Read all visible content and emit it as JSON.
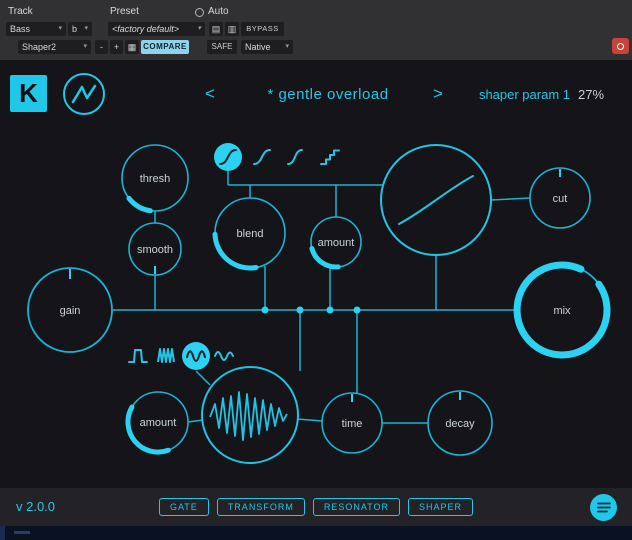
{
  "chrome": {
    "track_label": "Track",
    "preset_label": "Preset",
    "auto_label": "Auto",
    "track_value": "Bass",
    "track_sub_value": "b",
    "preset_value": "<factory default>",
    "bypass_label": "BYPASS",
    "device_value": "Shaper2",
    "minus_label": "-",
    "plus_label": "+",
    "compare_label": "COMPARE",
    "safe_label": "SAFE",
    "mode_value": "Native"
  },
  "header": {
    "logo_letter": "K",
    "prev_arrow": "<",
    "next_arrow": ">",
    "preset_title": "* gentle overload",
    "param_name": "shaper param 1",
    "param_value": "27%"
  },
  "graph": {
    "knobs": {
      "thresh": "thresh",
      "smooth": "smooth",
      "blend": "blend",
      "amount_top": "amount",
      "cut": "cut",
      "gain": "gain",
      "mix": "mix",
      "amount_bottom": "amount",
      "time": "time",
      "decay": "decay"
    }
  },
  "footer": {
    "version": "v 2.0.0",
    "tabs": [
      {
        "label": "GATE"
      },
      {
        "label": "TRANSFORM"
      },
      {
        "label": "RESONATOR"
      },
      {
        "label": "SHAPER"
      }
    ]
  },
  "icons": {
    "caret": "▾",
    "copy": "▤",
    "save": "▥",
    "slot": "▦"
  },
  "colors": {
    "accent": "#1fc9ea",
    "accent_dim": "#19b4d4",
    "compare_bg": "#8fd2ec",
    "chrome_bg": "#313134",
    "plugin_bg": "#141419"
  }
}
